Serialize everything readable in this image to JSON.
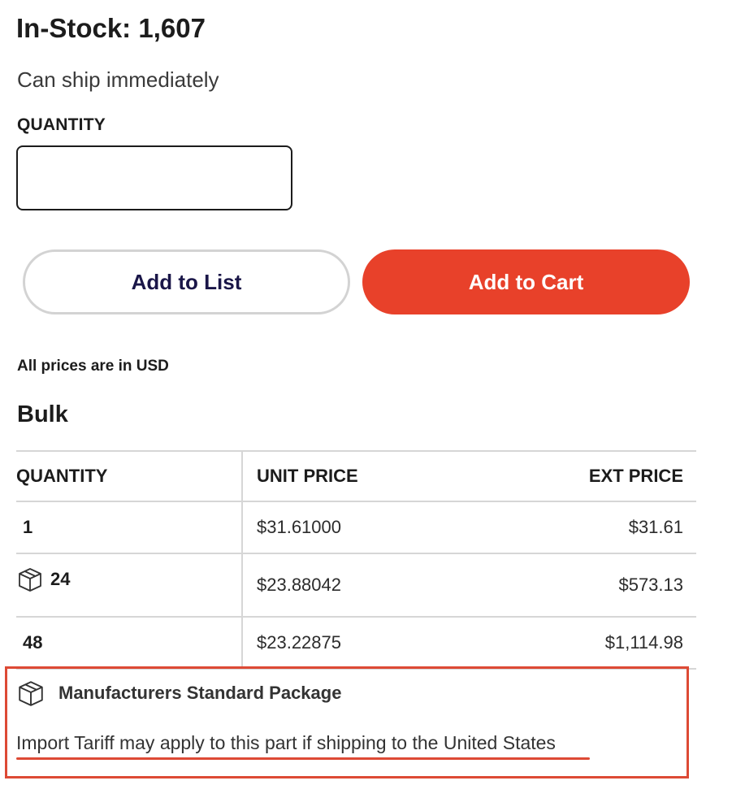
{
  "stock": {
    "heading": "In-Stock: 1,607",
    "ship_text": "Can ship immediately"
  },
  "quantity": {
    "label": "QUANTITY",
    "value": ""
  },
  "actions": {
    "add_to_list_label": "Add to List",
    "add_to_cart_label": "Add to Cart"
  },
  "pricing": {
    "currency_note": "All prices are in USD",
    "section_title": "Bulk",
    "headers": {
      "quantity": "QUANTITY",
      "unit_price": "UNIT PRICE",
      "ext_price": "EXT PRICE"
    },
    "rows": [
      {
        "quantity": "1",
        "unit_price": "$31.61000",
        "ext_price": "$31.61",
        "icon": ""
      },
      {
        "quantity": "24",
        "unit_price": "$23.88042",
        "ext_price": "$573.13",
        "icon": "package-box-icon"
      },
      {
        "quantity": "48",
        "unit_price": "$23.22875",
        "ext_price": "$1,114.98",
        "icon": ""
      }
    ]
  },
  "notice": {
    "package_label": "Manufacturers Standard Package",
    "package_icon": "package-box-icon",
    "tariff_text": "Import Tariff may apply to this part if shipping to the United States"
  },
  "colors": {
    "accent": "#e8412a",
    "highlight": "#dd4a35",
    "list_button_text": "#1a1648"
  }
}
